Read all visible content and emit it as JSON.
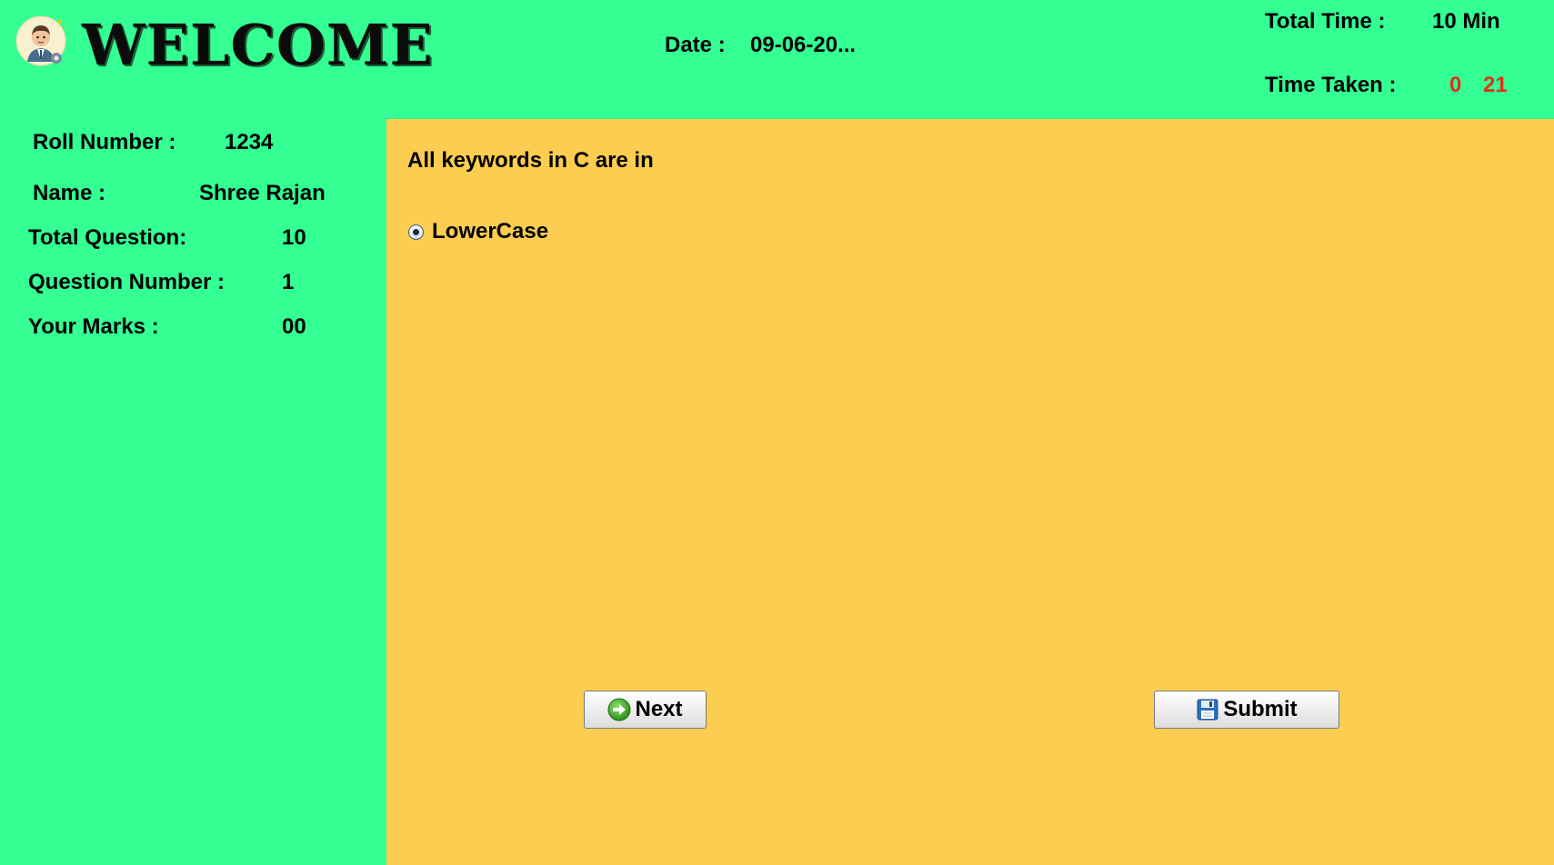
{
  "header": {
    "title": "WELCOME",
    "date_label": "Date :",
    "date_value": "09-06-20...",
    "total_time_label": "Total Time :",
    "total_time_value": "10 Min",
    "time_taken_label": "Time Taken :",
    "time_taken_minutes": "0",
    "time_taken_seconds": "21"
  },
  "sidebar": {
    "roll_label": "Roll Number :",
    "roll_value": "1234",
    "name_label": "Name :",
    "name_value": "Shree Rajan",
    "total_question_label": "Total Question:",
    "total_question_value": "10",
    "question_number_label": "Question Number :",
    "question_number_value": "1",
    "marks_label": "Your Marks :",
    "marks_value": "00"
  },
  "quiz": {
    "question": "All keywords in C are in",
    "option_label": "LowerCase",
    "option_selected": true
  },
  "buttons": {
    "next_label": "Next",
    "submit_label": "Submit"
  },
  "colors": {
    "background": "#33ff93",
    "panel": "#fccd50",
    "timer_accent": "#e0311b"
  },
  "icons": {
    "avatar": "user-avatar-icon",
    "next": "arrow-right-circle-icon",
    "submit": "floppy-disk-icon"
  }
}
